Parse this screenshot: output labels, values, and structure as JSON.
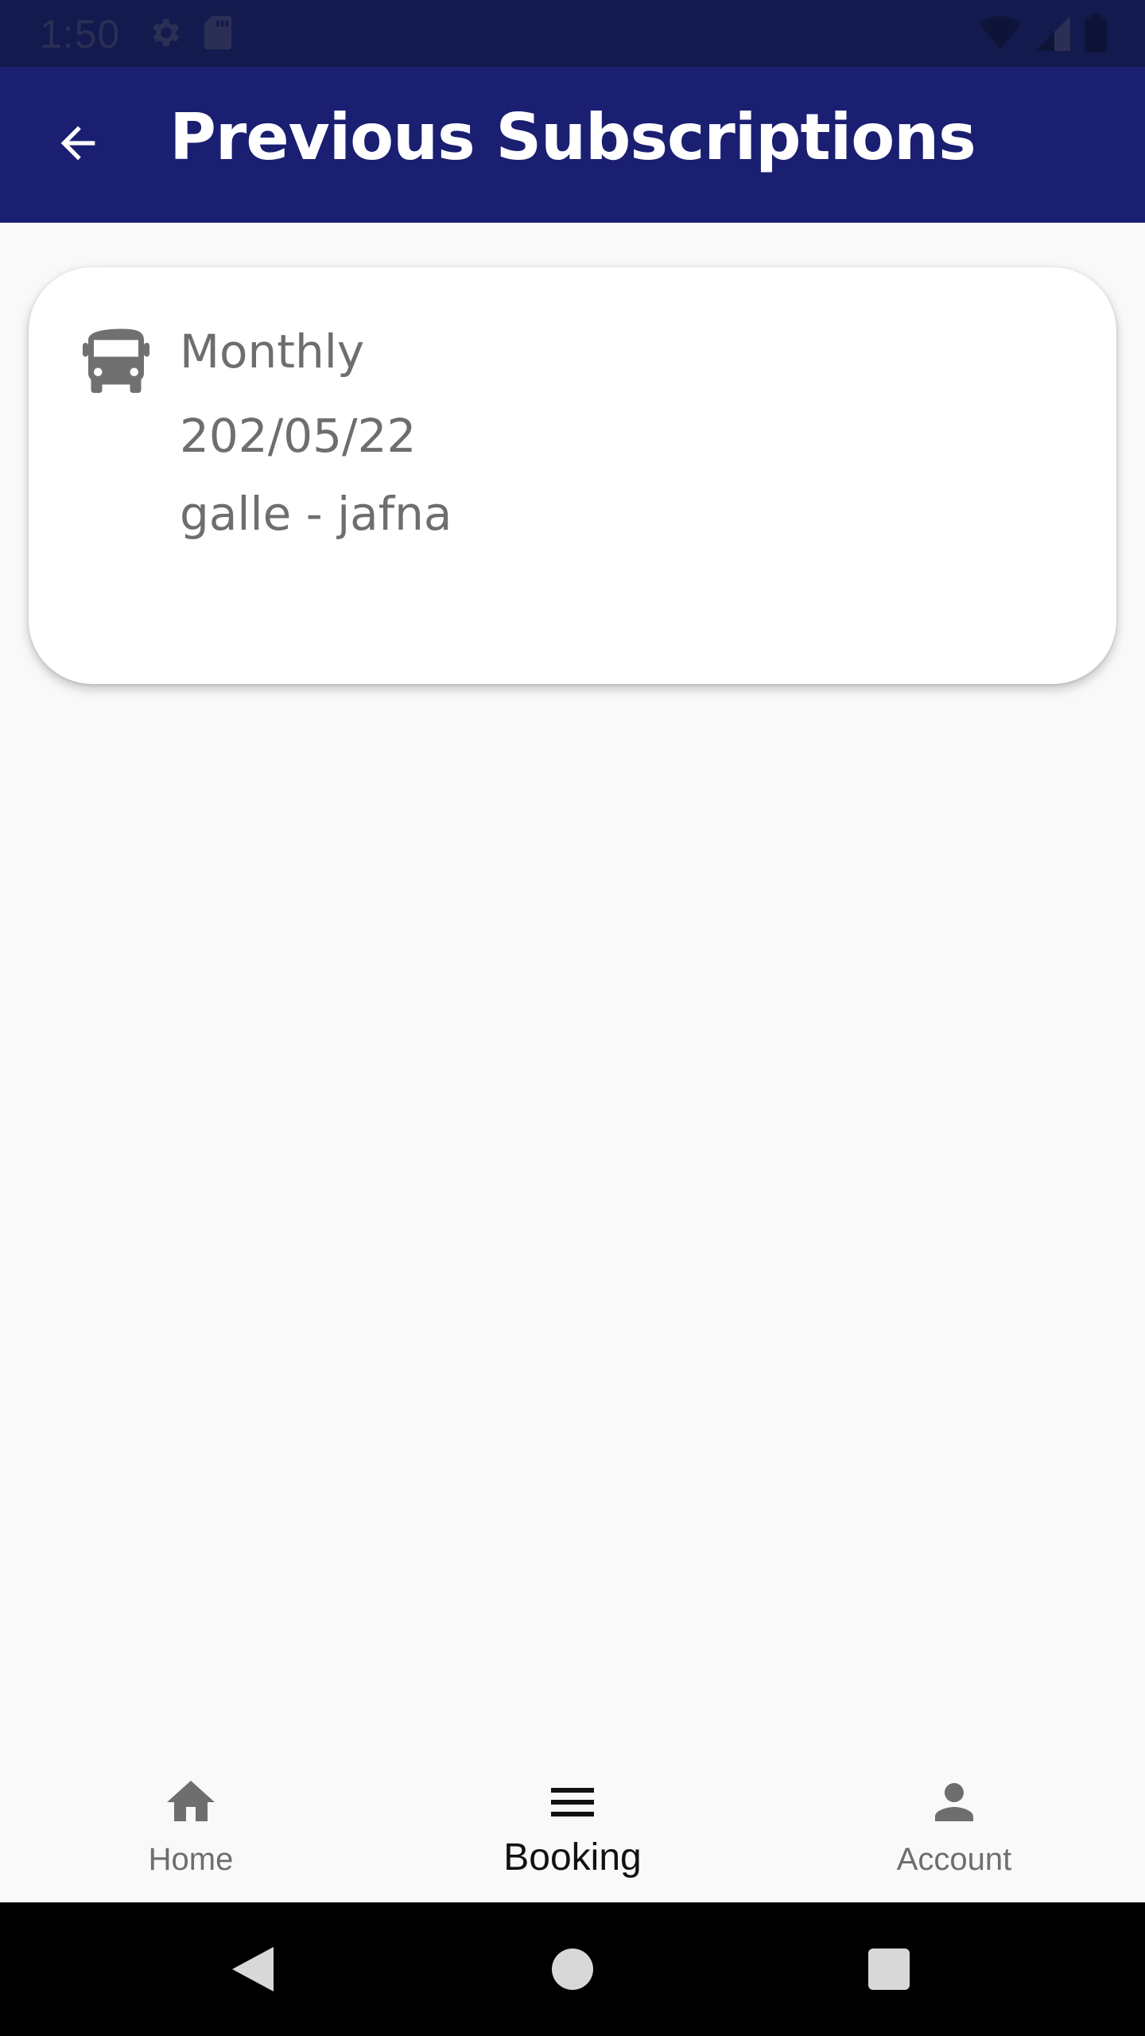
{
  "status_bar": {
    "time": "1:50",
    "icons_left": [
      "gear-icon",
      "sd-card-icon"
    ],
    "icons_right": [
      "wifi-icon",
      "cell-signal-icon",
      "battery-icon"
    ]
  },
  "app_bar": {
    "title": "Previous Subscriptions",
    "back_icon": "arrow-back-icon",
    "background": "#1a1f72"
  },
  "subscriptions": [
    {
      "icon": "bus-icon",
      "type": "Monthly",
      "date": "202/05/22",
      "route": "galle - jafna"
    }
  ],
  "bottom_nav": {
    "items": [
      {
        "label": "Home",
        "icon": "home-icon",
        "active": false
      },
      {
        "label": "Booking",
        "icon": "menu-icon",
        "active": true
      },
      {
        "label": "Account",
        "icon": "person-icon",
        "active": false
      }
    ]
  },
  "system_nav": {
    "buttons": [
      "back-triangle-icon",
      "home-circle-icon",
      "recents-square-icon"
    ]
  },
  "colors": {
    "status_bar": "#121a4e",
    "app_bar": "#1a1f72",
    "text_secondary": "#6e6e6e",
    "background": "#f9f9f9"
  }
}
